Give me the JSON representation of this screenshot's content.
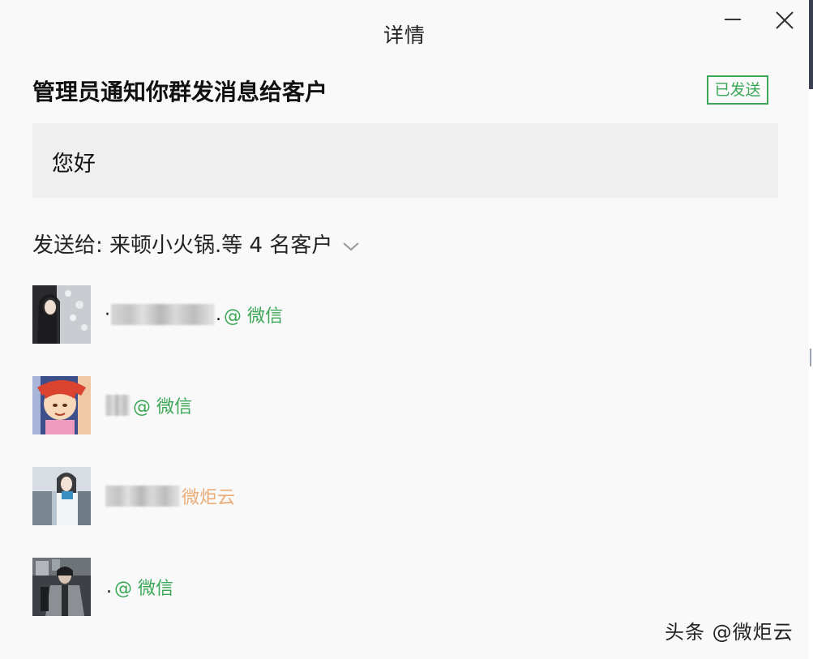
{
  "window": {
    "title": "详情"
  },
  "notification": {
    "heading": "管理员通知你群发消息给客户",
    "status": "已发送",
    "message": "您好"
  },
  "recipients": {
    "summary": "发送给: 来顿小火锅.等 4 名客户"
  },
  "customers": [
    {
      "prefix": "·",
      "suffix": ".",
      "source": "@ 微信"
    },
    {
      "prefix": "",
      "suffix": "",
      "source": "@ 微信"
    },
    {
      "prefix": "",
      "suffix": "",
      "source": "微炬云"
    },
    {
      "prefix": "",
      "suffix": ".",
      "source": "@ 微信"
    }
  ],
  "watermark": "头条 @微炬云",
  "colors": {
    "accent_green": "#3aa757",
    "message_bg": "#efefef",
    "window_bg": "#f9f9f9"
  }
}
